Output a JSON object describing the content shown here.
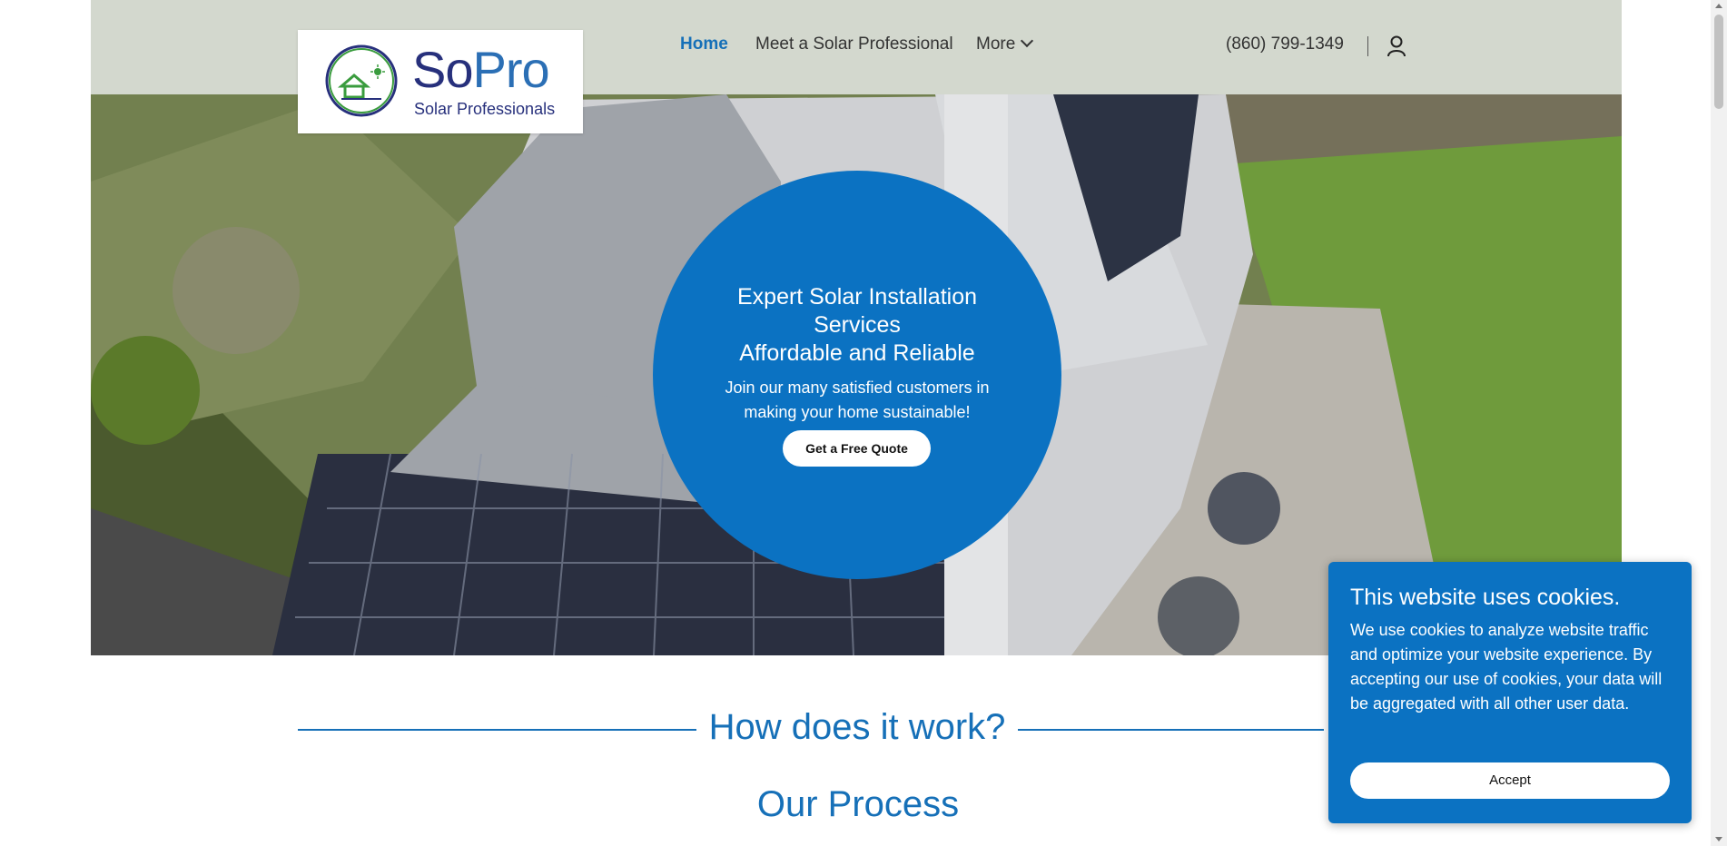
{
  "header": {
    "logo": {
      "brand_so": "So",
      "brand_pro": "Pro",
      "tagline": "Solar Professionals"
    },
    "nav": {
      "home": "Home",
      "meet": "Meet a Solar Professional",
      "more": "More"
    },
    "phone": "(860) 799-1349",
    "icons": {
      "user": "user-icon",
      "more_dropdown": "chevron-down-icon"
    }
  },
  "hero": {
    "title_line1": "Expert Solar Installation",
    "title_line2": "Services",
    "title_line3": "Affordable and Reliable",
    "subtitle": "Join our many satisfied customers in making your home sustainable!",
    "cta_label": "Get a Free Quote"
  },
  "sections": {
    "how_title": "How does it work?",
    "process_title": "Our Process"
  },
  "cookie_banner": {
    "title": "This website uses cookies.",
    "body": "We use cookies to analyze website traffic and optimize your website experience. By accepting our use of cookies, your data will be aggregated with all other user data.",
    "accept_label": "Accept"
  },
  "colors": {
    "accent": "#0b72c2",
    "nav_active": "#1670b8",
    "logo_navy": "#27307c"
  }
}
